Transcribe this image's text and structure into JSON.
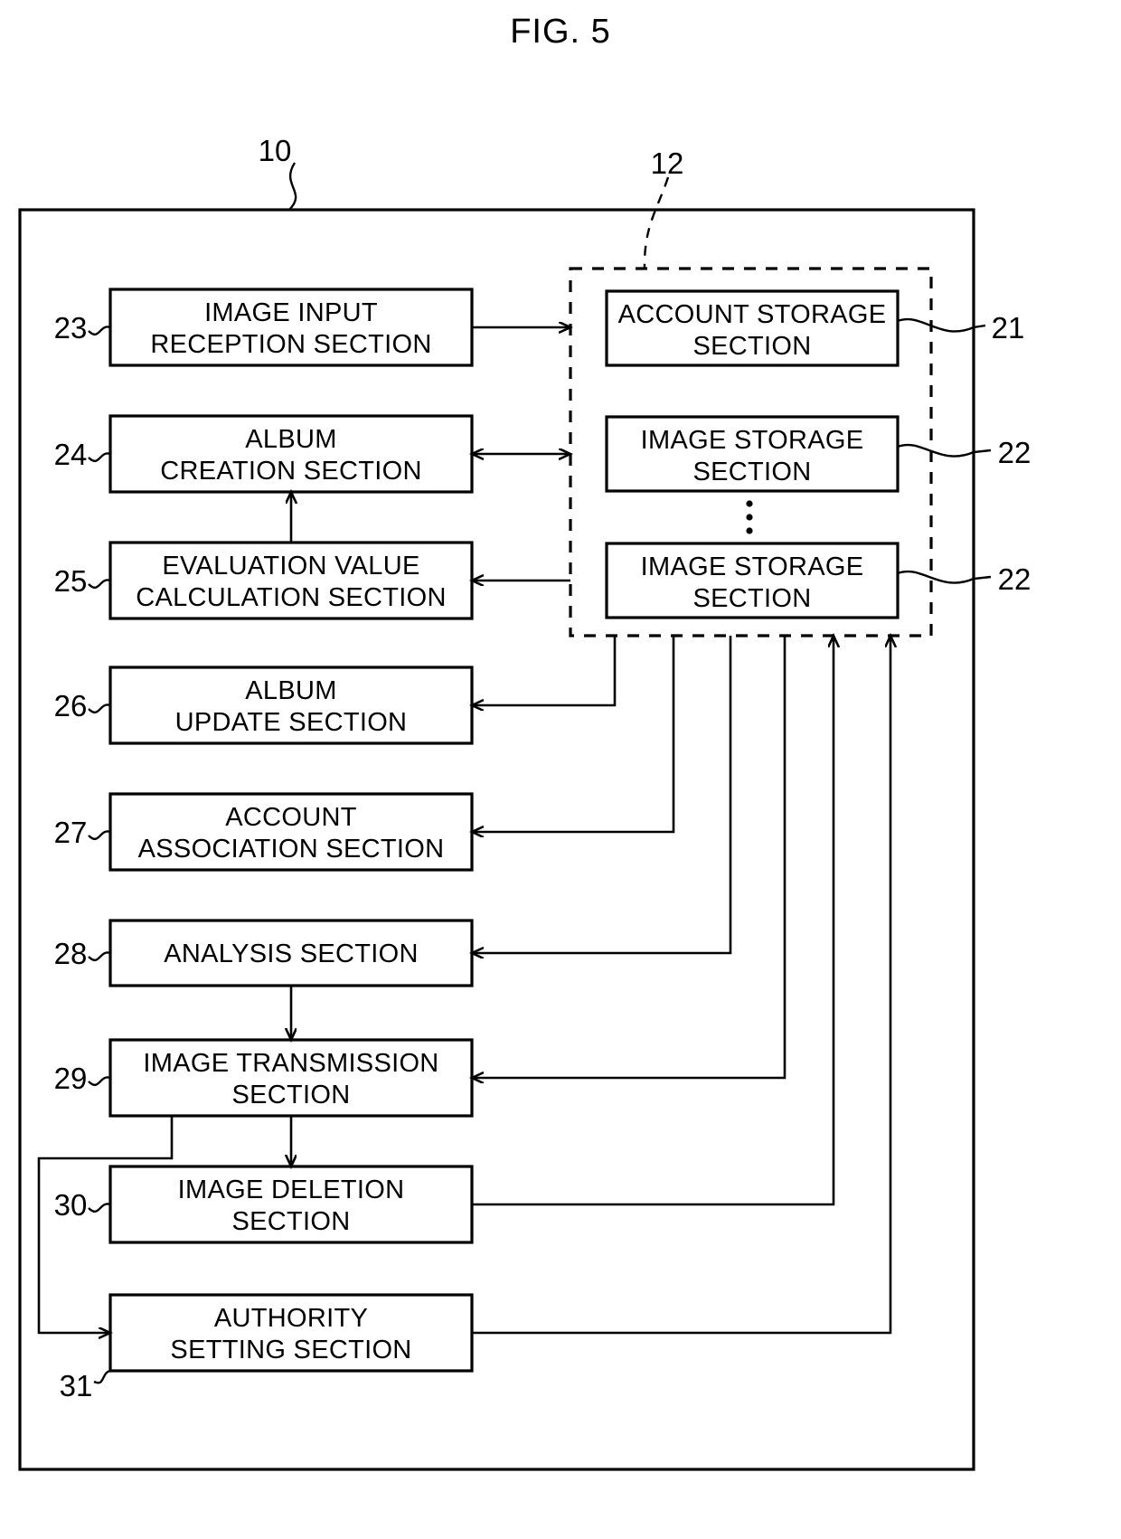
{
  "figure": {
    "title": "FIG. 5",
    "outer_ref": "10",
    "storage_group_ref": "12"
  },
  "left_blocks": [
    {
      "ref": "23",
      "line1": "IMAGE INPUT",
      "line2": "RECEPTION SECTION"
    },
    {
      "ref": "24",
      "line1": "ALBUM",
      "line2": "CREATION SECTION"
    },
    {
      "ref": "25",
      "line1": "EVALUATION VALUE",
      "line2": "CALCULATION SECTION"
    },
    {
      "ref": "26",
      "line1": "ALBUM",
      "line2": "UPDATE SECTION"
    },
    {
      "ref": "27",
      "line1": "ACCOUNT",
      "line2": "ASSOCIATION SECTION"
    },
    {
      "ref": "28",
      "line1": "ANALYSIS SECTION",
      "line2": ""
    },
    {
      "ref": "29",
      "line1": "IMAGE TRANSMISSION",
      "line2": "SECTION"
    },
    {
      "ref": "30",
      "line1": "IMAGE DELETION",
      "line2": "SECTION"
    },
    {
      "ref": "31",
      "line1": "AUTHORITY",
      "line2": "SETTING SECTION"
    }
  ],
  "right_blocks": [
    {
      "ref": "21",
      "line1": "ACCOUNT STORAGE",
      "line2": "SECTION"
    },
    {
      "ref": "22",
      "line1": "IMAGE STORAGE",
      "line2": "SECTION"
    },
    {
      "ref": "22",
      "line1": "IMAGE STORAGE",
      "line2": "SECTION"
    }
  ],
  "colors": {
    "ink": "#000000",
    "paper": "#ffffff"
  }
}
